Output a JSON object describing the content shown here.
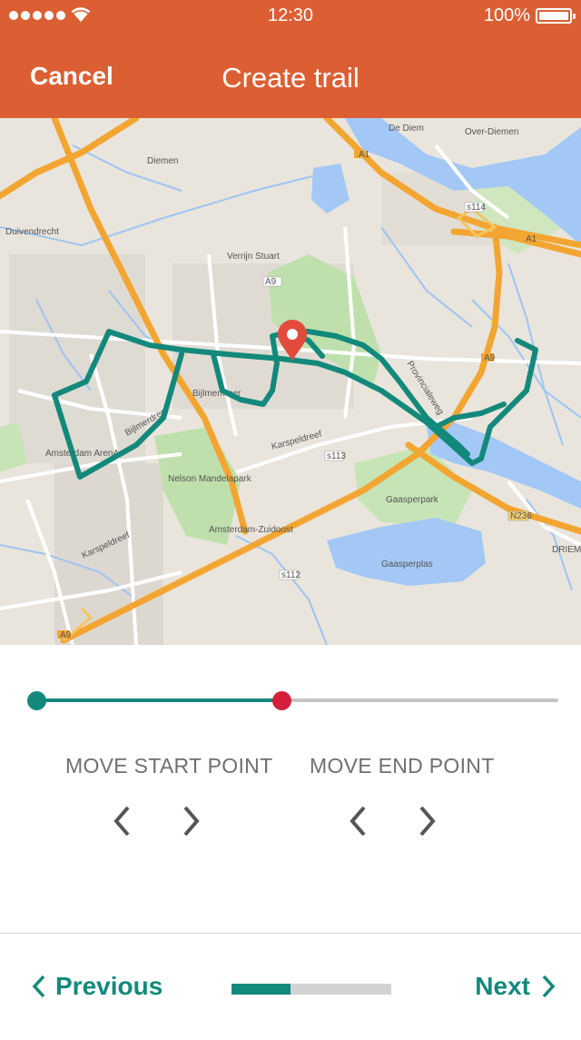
{
  "status_bar": {
    "time": "12:30",
    "battery_text": "100%",
    "battery_level": 1.0
  },
  "header": {
    "cancel_label": "Cancel",
    "title": "Create trail",
    "background_color": "#dc5f33"
  },
  "map": {
    "labels": {
      "diemen": "Diemen",
      "over_diemen": "Over-Diemen",
      "de_diem": "De Diem",
      "duivendrecht": "Duivendrecht",
      "verrijn_stuart": "Verrijn Stuart",
      "bijlmermeer": "Bijlmermeer",
      "bijlmerdreef": "Bijlmerdreef",
      "karspeldreef": "Karspeldreef",
      "karspeldreef_2": "Karspeldreef",
      "amsterdam_arena": "Amsterdam ArenA",
      "nelson_park": "Nelson Mandelapark",
      "amsterdam_zuidoost": "Amsterdam-Zuidoost",
      "gaasperpark": "Gaasperpark",
      "gaasperplas": "Gaasperplas",
      "provincialeweg": "Provincialeweg",
      "driemond": "DRIEMON",
      "a1": "A1",
      "a1b": "A1",
      "a9": "A9",
      "a9b": "A9",
      "a9c": "A9",
      "s114": "s114",
      "s113": "s113",
      "s112": "s112",
      "n236": "N236"
    },
    "trail_color": "#13897b",
    "marker_color": "#e24b3b"
  },
  "trail_slider": {
    "start_fraction": 0.0,
    "end_fraction": 0.47,
    "start_color": "#13897b",
    "end_color": "#d31f3a"
  },
  "controls": {
    "move_start_label": "MOVE START POINT",
    "move_end_label": "MOVE END POINT",
    "prev_icon": "chevron-left-icon",
    "next_icon": "chevron-right-icon"
  },
  "footer": {
    "previous_label": "Previous",
    "next_label": "Next",
    "step_progress": 0.37
  }
}
